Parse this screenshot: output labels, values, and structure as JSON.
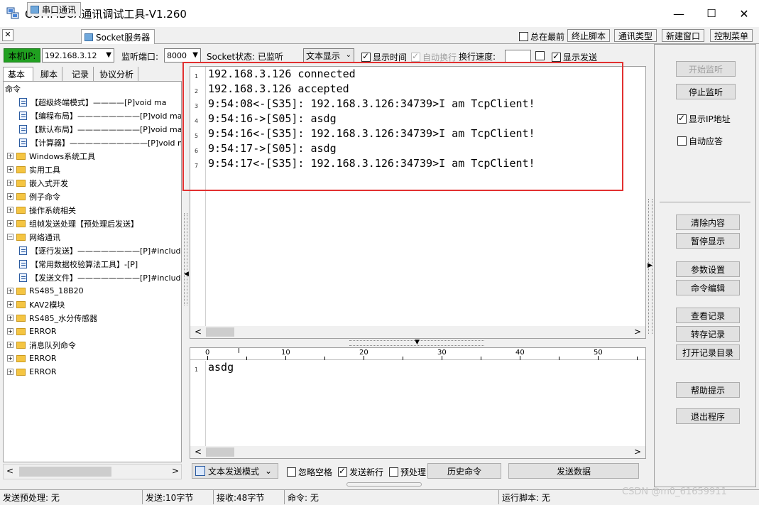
{
  "window": {
    "title": "COMMBOX通讯调试工具-V1.260",
    "controls": [
      "—",
      "☐",
      "✕"
    ]
  },
  "tabs": [
    {
      "label": "串口通讯"
    },
    {
      "label": "Socket服务器"
    }
  ],
  "top_toolbar": {
    "always_on_top": "总在最前",
    "stop_script": "终止脚本",
    "comm_type": "通讯类型",
    "new_window": "新建窗口",
    "control_menu": "控制菜单"
  },
  "row2": {
    "local_ip_label": "本机IP:",
    "local_ip_value": "192.168.3.12",
    "port_label": "监听端口:",
    "port_value": "8000",
    "socket_state": "Socket状态: 已监听",
    "display_mode": "文本显示",
    "show_time": "显示时间",
    "auto_wrap": "自动换行",
    "wrap_speed_label": "换行速度:",
    "show_send": "显示发送"
  },
  "left_tabs": [
    "基本",
    "脚本",
    "记录",
    "协议分析"
  ],
  "tree": [
    {
      "type": "root",
      "text": "命令"
    },
    {
      "type": "doc",
      "text": "【超级终端模式】————[P]void ma"
    },
    {
      "type": "doc",
      "text": "【编程布局】————————[P]void ma"
    },
    {
      "type": "doc",
      "text": "【默认布局】————————[P]void ma"
    },
    {
      "type": "doc",
      "text": "【计算器】——————————[P]void ma"
    },
    {
      "type": "folder",
      "text": "Windows系统工具"
    },
    {
      "type": "folder",
      "text": "实用工具"
    },
    {
      "type": "folder",
      "text": "嵌入式开发"
    },
    {
      "type": "folder",
      "text": "例子命令"
    },
    {
      "type": "folder",
      "text": "操作系统相关"
    },
    {
      "type": "folder",
      "text": "组帧发送处理【预处理后发送】"
    },
    {
      "type": "folder",
      "text": "网络通讯"
    },
    {
      "type": "doc",
      "text": "【逐行发送】————————[P]#includ"
    },
    {
      "type": "doc",
      "text": "【常用数据校验算法工具】-[P]"
    },
    {
      "type": "doc",
      "text": "【发送文件】————————[P]#includ"
    },
    {
      "type": "folder",
      "text": "RS485_18B20"
    },
    {
      "type": "folder",
      "text": "KAV2模块"
    },
    {
      "type": "folder",
      "text": "RS485_水分传感器"
    },
    {
      "type": "folder",
      "text": "ERROR"
    },
    {
      "type": "folder",
      "text": "消息队列命令"
    },
    {
      "type": "folder",
      "text": "ERROR"
    },
    {
      "type": "folder",
      "text": "ERROR"
    }
  ],
  "receive_lines": [
    {
      "n": "1",
      "text": "192.168.3.126 connected"
    },
    {
      "n": "2",
      "text": "192.168.3.126 accepted"
    },
    {
      "n": "3",
      "text": "9:54:08<-[S35]: 192.168.3.126:34739>I am TcpClient!"
    },
    {
      "n": "4",
      "text": "9:54:16->[S05]: asdg"
    },
    {
      "n": "5",
      "text": "9:54:16<-[S35]: 192.168.3.126:34739>I am TcpClient!"
    },
    {
      "n": "6",
      "text": "9:54:17->[S05]: asdg"
    },
    {
      "n": "7",
      "text": "9:54:17<-[S35]: 192.168.3.126:34739>I am TcpClient!"
    }
  ],
  "ruler_marks": [
    "0",
    "10",
    "20",
    "30",
    "40",
    "50"
  ],
  "send_lines": [
    {
      "n": "1",
      "text": "asdg"
    }
  ],
  "right_buttons": {
    "start_listen": "开始监听",
    "stop_listen": "停止监听",
    "show_ip": "显示IP地址",
    "auto_reply": "自动应答",
    "clear": "清除内容",
    "pause": "暂停显示",
    "params": "参数设置",
    "cmd_edit": "命令编辑",
    "view_log": "查看记录",
    "save_log": "转存记录",
    "open_log_dir": "打开记录目录",
    "help": "帮助提示",
    "exit": "退出程序"
  },
  "send_row": {
    "send_mode": "文本发送模式",
    "ignore_space": "忽略空格",
    "send_newline": "发送新行",
    "preprocess": "预处理",
    "history": "历史命令",
    "send_data": "发送数据"
  },
  "status": {
    "pre_process": "发送预处理: 无",
    "sent": "发送:10字节",
    "received": "接收:48字节",
    "command": "命令: 无",
    "run_script": "运行脚本: 无",
    "watermark": "CSDN @m0_61659911"
  }
}
